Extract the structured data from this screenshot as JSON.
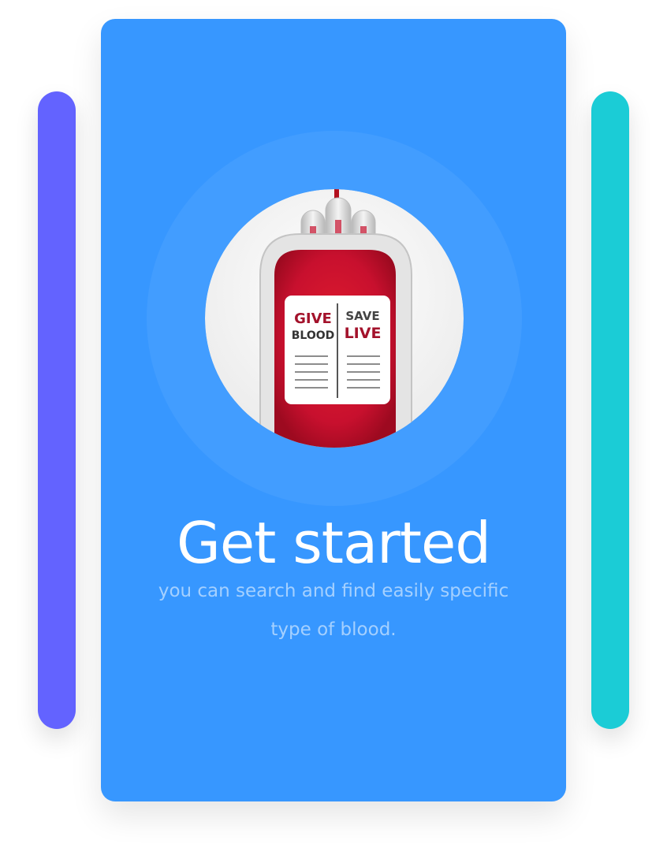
{
  "colors": {
    "main_card": "#3797FF",
    "side_card_left": "#6363FF",
    "side_card_right": "#1BCCD6",
    "blood_red": "#C8102E",
    "bag_gray": "#D9D9D9"
  },
  "illustration": {
    "icon": "blood-bag-icon",
    "label": {
      "left_line1": "GIVE",
      "left_line2": "BLOOD",
      "right_line1": "SAVE",
      "right_line2": "LIVE"
    }
  },
  "content": {
    "title": "Get started",
    "subtitle": "you can search and find easily specific type of blood."
  }
}
